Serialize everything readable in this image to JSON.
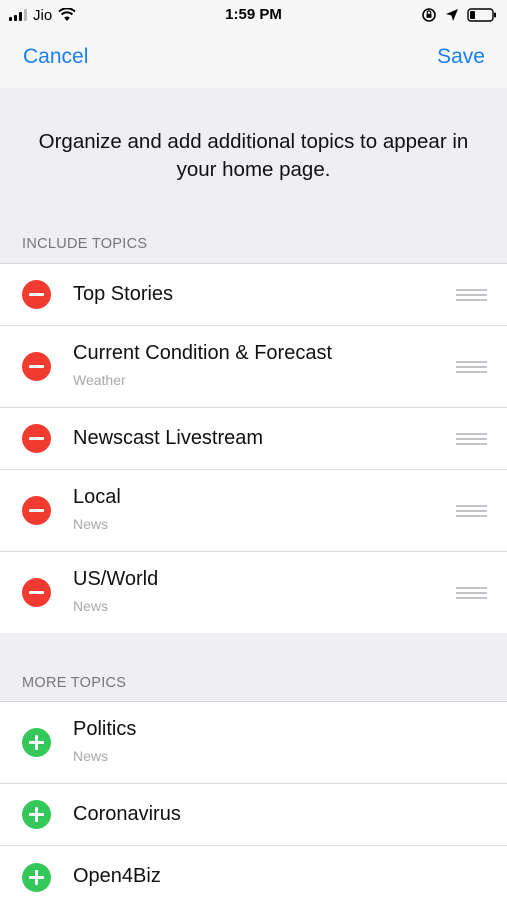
{
  "status_bar": {
    "carrier": "Jio",
    "time": "1:59 PM"
  },
  "nav": {
    "cancel_label": "Cancel",
    "save_label": "Save",
    "accent_color": "#1a7ff5"
  },
  "intro_text": "Organize and add additional topics to appear in your home page.",
  "include_section": {
    "header": "INCLUDE TOPICS",
    "items": [
      {
        "title": "Top Stories",
        "subtitle": ""
      },
      {
        "title": "Current Condition & Forecast",
        "subtitle": "Weather"
      },
      {
        "title": "Newscast Livestream",
        "subtitle": ""
      },
      {
        "title": "Local",
        "subtitle": "News"
      },
      {
        "title": "US/World",
        "subtitle": "News"
      }
    ]
  },
  "more_section": {
    "header": "MORE TOPICS",
    "items": [
      {
        "title": "Politics",
        "subtitle": "News"
      },
      {
        "title": "Coronavirus",
        "subtitle": ""
      },
      {
        "title": "Open4Biz",
        "subtitle": ""
      }
    ]
  },
  "icons": {
    "remove": "remove-circle-icon",
    "add": "add-circle-icon",
    "reorder": "reorder-handle-icon",
    "wifi": "wifi-icon",
    "battery": "battery-icon",
    "location": "location-arrow-icon",
    "rotation_lock": "rotation-lock-icon"
  },
  "colors": {
    "remove": "#f23b30",
    "add": "#34c759",
    "section_bg": "#eeeef3"
  }
}
